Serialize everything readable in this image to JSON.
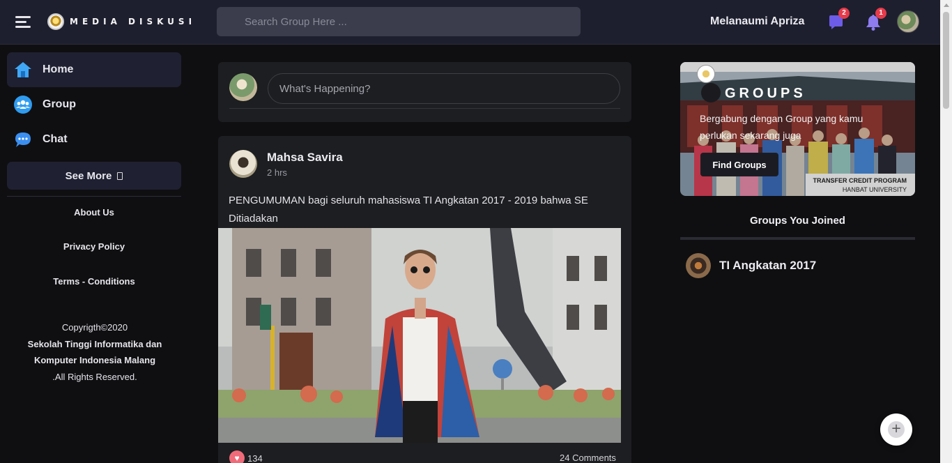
{
  "header": {
    "logo_text": "MEDIA DISKUSI",
    "search_placeholder": "Search Group Here ...",
    "username": "Melanaumi Apriza",
    "chat_badge": "2",
    "notif_badge": "1"
  },
  "sidebar": {
    "items": [
      {
        "label": "Home",
        "icon": "home-icon",
        "active": true
      },
      {
        "label": "Group",
        "icon": "group-icon",
        "active": false
      },
      {
        "label": "Chat",
        "icon": "chat-icon",
        "active": false
      }
    ],
    "see_more": "See More",
    "links": [
      "About Us",
      "Privacy Policy",
      "Terms - Conditions"
    ],
    "copyright": {
      "line1": "Copyrigth©2020",
      "line2": "Sekolah Tinggi Informatika dan",
      "line3": "Komputer Indonesia Malang",
      "line4": ".All Rights Reserved."
    }
  },
  "composer": {
    "placeholder": "What's Happening?"
  },
  "post": {
    "author": "Mahsa Savira",
    "time": "2 hrs",
    "text": "PENGUMUMAN bagi seluruh mahasiswa TI Angkatan 2017 - 2019 bahwa SE Ditiadakan",
    "likes": "134",
    "comments": "24 Comments"
  },
  "groups_card": {
    "title": "GROUPS",
    "subtitle": "Bergabung dengan Group yang kamu perlukan sekarang juga",
    "button": "Find Groups",
    "banner_line1": "TRANSFER CREDIT PROGRAM",
    "banner_line2": "HANBAT UNIVERSITY"
  },
  "groups_joined": {
    "title": "Groups You Joined",
    "items": [
      {
        "name": "TI Angkatan 2017"
      }
    ]
  },
  "colors": {
    "accent_purple": "#6c5ce7",
    "badge_red": "#e53b4b",
    "heart_pink": "#f06b7a"
  }
}
